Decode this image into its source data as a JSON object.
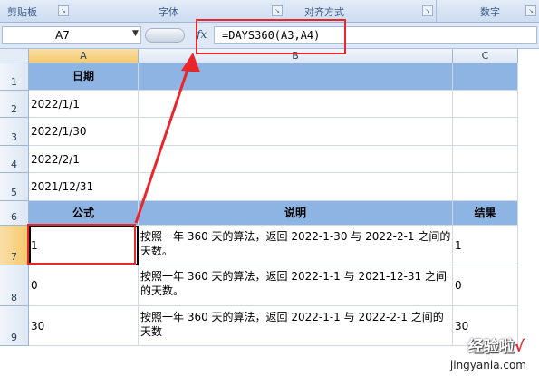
{
  "ribbon": {
    "groups": [
      {
        "label": "剪贴板"
      },
      {
        "label": "字体"
      },
      {
        "label": "对齐方式"
      },
      {
        "label": "数字"
      }
    ]
  },
  "formula_bar": {
    "name_box": "A7",
    "fx_label": "fx",
    "formula": "=DAYS360(A3,A4)"
  },
  "columns": [
    "A",
    "B",
    "C"
  ],
  "rows": [
    "1",
    "2",
    "3",
    "4",
    "5",
    "6",
    "7",
    "8",
    "9"
  ],
  "sheet": {
    "header1": "日期",
    "dates": [
      "2022/1/1",
      "2022/1/30",
      "2022/2/1",
      "2021/12/31"
    ],
    "header6": {
      "a": "公式",
      "b": "说明",
      "c": "结果"
    },
    "data": [
      {
        "a": "1",
        "b": "按照一年 360 天的算法，返回 2022-1-30 与 2022-2-1 之间的天数。",
        "c": "1"
      },
      {
        "a": "0",
        "b": "按照一年 360 天的算法，返回 2022-1-1 与 2021-12-31 之间的天数。",
        "c": "0"
      },
      {
        "a": "30",
        "b": "按照一年 360 天的算法，返回 2022-1-1 与 2022-2-1 之间的天数",
        "c": "30"
      }
    ]
  },
  "watermark": {
    "text": "经验啦",
    "check": "√",
    "url": "jingyanla.com"
  },
  "colors": {
    "header_fill": "#8eb4e3",
    "annotation": "#e8262b"
  }
}
